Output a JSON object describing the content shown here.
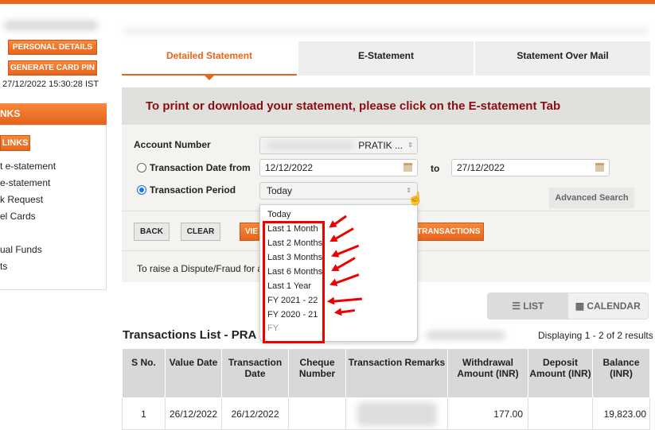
{
  "sidebar": {
    "personal_details": "PERSONAL DETAILS",
    "generate_card_pin": "GENERATE CARD PIN",
    "last_login": "27/12/2022 15:30:28 IST",
    "links_header": "NKS",
    "links_button": "LINKS",
    "items": [
      "t e-statement",
      "e-statement",
      "k Request",
      "el Cards",
      "ual Funds",
      "ts"
    ]
  },
  "tabs": [
    {
      "label": "Detailed Statement",
      "active": true
    },
    {
      "label": "E-Statement"
    },
    {
      "label": "Statement Over Mail"
    }
  ],
  "banner": "To print or download your statement, please click on the E-statement Tab",
  "form": {
    "account_label": "Account Number",
    "account_value": "PRATIK ...",
    "date_from_label": "Transaction Date from",
    "date_from": "12/12/2022",
    "to_label": "to",
    "date_to": "27/12/2022",
    "period_label": "Transaction Period",
    "period_value": "Today",
    "advanced_search": "Advanced Search",
    "back": "BACK",
    "clear": "CLEAR",
    "view": "VIE",
    "transactions": "TRANSACTIONS",
    "dispute": "To raise a Dispute/Fraud for ar"
  },
  "dropdown": {
    "options": [
      "Today",
      "Last 1 Month",
      "Last 2 Months",
      "Last 3 Months",
      "Last 6 Months",
      "Last 1 Year",
      "FY 2021 - 22",
      "FY 2020 - 21",
      "FY"
    ],
    "annotation_color": "#e00000"
  },
  "view_toggle": {
    "list": "LIST",
    "calendar": "CALENDAR"
  },
  "list": {
    "title": "Transactions List - PRA",
    "displaying": "Displaying 1 - 2 of 2 results"
  },
  "table": {
    "headers": [
      "S No.",
      "Value Date",
      "Transaction Date",
      "Cheque Number",
      "Transaction Remarks",
      "Withdrawal Amount (INR)",
      "Deposit Amount (INR)",
      "Balance (INR)"
    ],
    "rows": [
      [
        "1",
        "26/12/2022",
        "26/12/2022",
        "",
        "",
        "177.00",
        "",
        "19,823.00"
      ]
    ]
  },
  "colors": {
    "accent": "#e8661c",
    "banner_text": "#8b0c13"
  }
}
